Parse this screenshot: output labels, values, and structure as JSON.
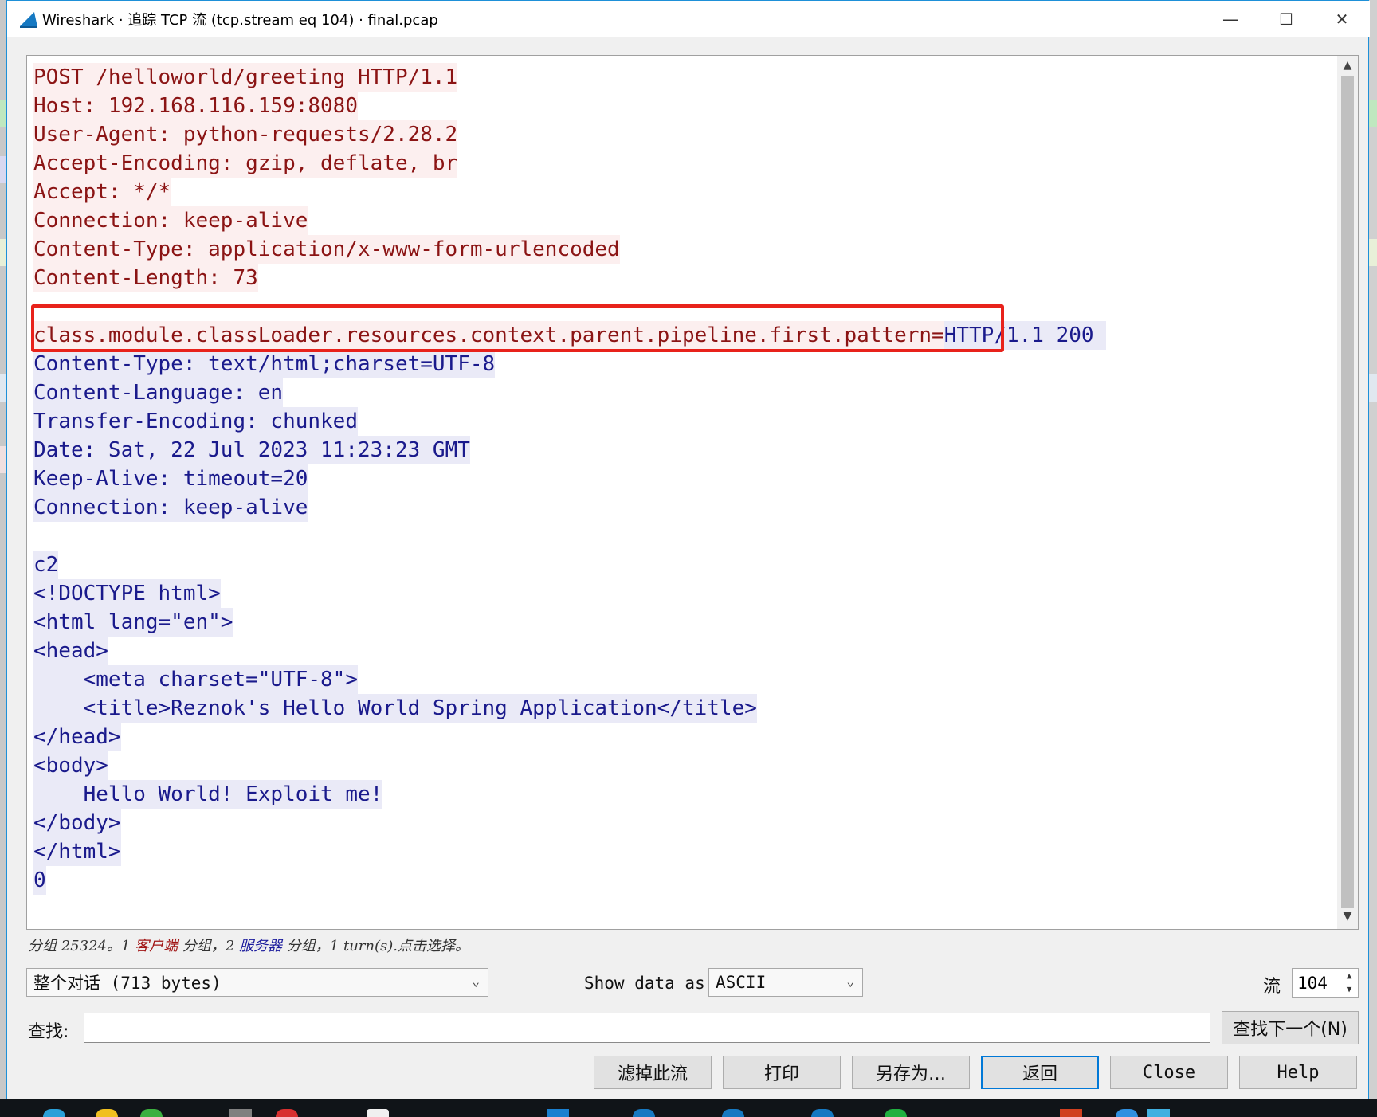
{
  "window": {
    "title": "Wireshark · 追踪 TCP 流 (tcp.stream eq 104) · final.pcap",
    "minimize_glyph": "—",
    "maximize_glyph": "☐",
    "close_glyph": "✕"
  },
  "stream": {
    "client_lines": [
      "POST /helloworld/greeting HTTP/1.1",
      "Host: 192.168.116.159:8080",
      "User-Agent: python-requests/2.28.2",
      "Accept-Encoding: gzip, deflate, br",
      "Accept: */*",
      "Connection: keep-alive",
      "Content-Type: application/x-www-form-urlencoded",
      "Content-Length: 73"
    ],
    "client_payload": "class.module.classLoader.resources.context.parent.pipeline.first.pattern=",
    "server_first": "HTTP/1.1 200 ",
    "server_lines": [
      "Content-Type: text/html;charset=UTF-8",
      "Content-Language: en",
      "Transfer-Encoding: chunked",
      "Date: Sat, 22 Jul 2023 11:23:23 GMT",
      "Keep-Alive: timeout=20",
      "Connection: keep-alive",
      "",
      "c2",
      "<!DOCTYPE html>",
      "<html lang=\"en\">",
      "<head>",
      "    <meta charset=\"UTF-8\">",
      "    <title>Reznok's Hello World Spring Application</title>",
      "</head>",
      "<body>",
      "    Hello World! Exploit me!",
      "</body>",
      "</html>",
      "0"
    ]
  },
  "status": {
    "prefix": "分组 25324。1 ",
    "client_word": "客户端",
    "middle": " 分组，2 ",
    "server_word": "服务器",
    "suffix": " 分组，1 turn(s).点击选择。"
  },
  "controls": {
    "conversation_select": "整个对话 (713 bytes)",
    "show_data_as_label": "Show data as",
    "show_data_as_value": "ASCII",
    "stream_label": "流",
    "stream_value": "104",
    "find_label": "查找:",
    "find_value": "",
    "find_next_label": "查找下一个(N)"
  },
  "buttons": {
    "filter_out": "滤掉此流",
    "print": "打印",
    "save_as": "另存为…",
    "back": "返回",
    "close": "Close",
    "help": "Help"
  },
  "colors": {
    "client_text": "#8b1414",
    "client_bg": "#fcefef",
    "server_text": "#1a1a8c",
    "server_bg": "#eaeaf7",
    "highlight_box": "#e8221b",
    "default_button_border": "#0078d7"
  },
  "icons": {
    "app": "wireshark-fin-icon",
    "dropdown": "chevron-down-icon",
    "spinner": "spin-updown-icon"
  }
}
